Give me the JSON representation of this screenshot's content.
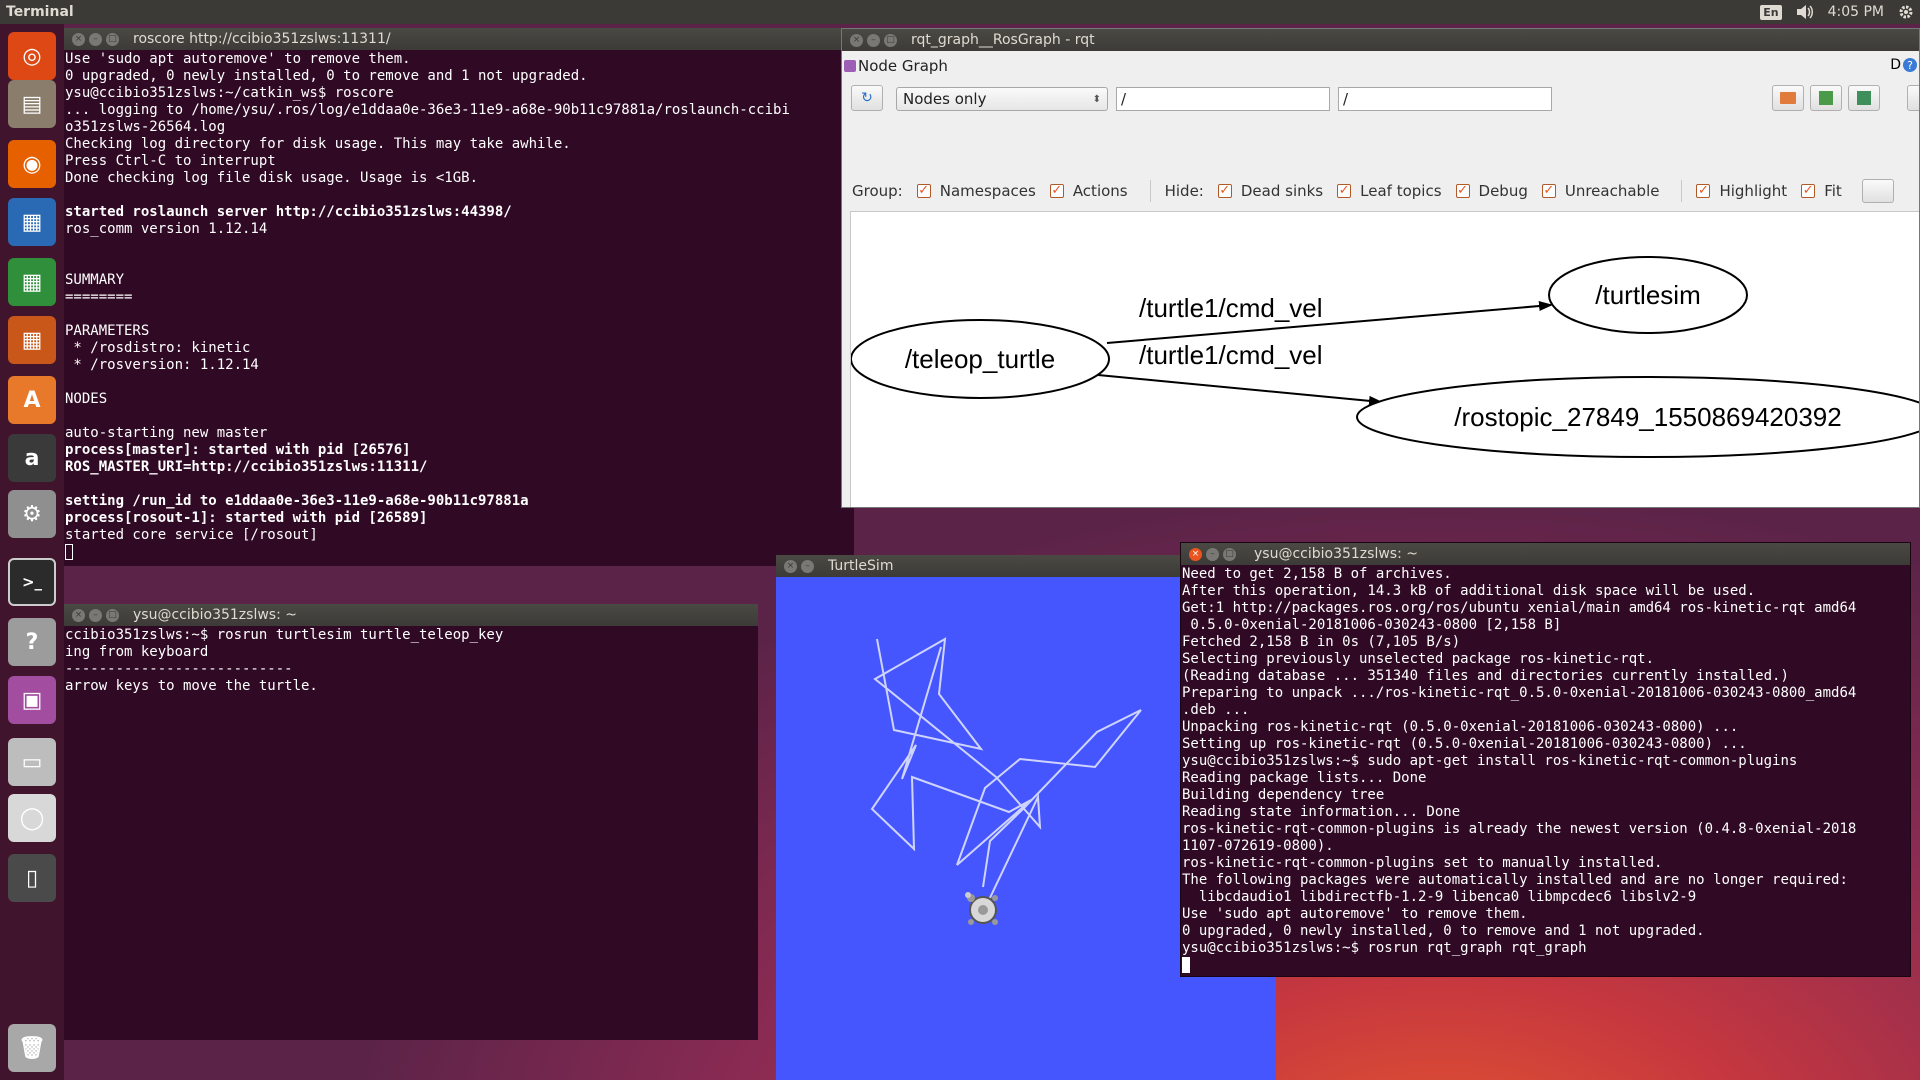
{
  "topbar": {
    "app_title": "Terminal",
    "keyboard": "En",
    "time": "4:05 PM"
  },
  "launcher": {
    "items": [
      {
        "name": "ubuntu-dash-icon",
        "color": "#dd4814",
        "glyph": "◎"
      },
      {
        "name": "files-icon",
        "color": "#8a7d6b",
        "glyph": "▤"
      },
      {
        "name": "firefox-icon",
        "color": "#e66000",
        "glyph": "◉"
      },
      {
        "name": "writer-icon",
        "color": "#2a6ab4",
        "glyph": "▦"
      },
      {
        "name": "calc-icon",
        "color": "#2f8f3b",
        "glyph": "▦"
      },
      {
        "name": "impress-icon",
        "color": "#c9571a",
        "glyph": "▦"
      },
      {
        "name": "software-center-icon",
        "color": "#e8782a",
        "glyph": "A"
      },
      {
        "name": "amazon-icon",
        "color": "#3a3a3a",
        "glyph": "a"
      },
      {
        "name": "system-settings-icon",
        "color": "#8f8f8f",
        "glyph": "⚙"
      },
      {
        "name": "terminal-icon",
        "color": "#2b2b2b",
        "glyph": ">_"
      },
      {
        "name": "help-icon",
        "color": "#9c9c9c",
        "glyph": "?"
      },
      {
        "name": "workspaces-icon",
        "color": "#a24d9f",
        "glyph": "▣"
      },
      {
        "name": "drive-icon",
        "color": "#bdbdbd",
        "glyph": "▭"
      },
      {
        "name": "dvd-icon",
        "color": "#d8d8d8",
        "glyph": "◯"
      },
      {
        "name": "device-icon",
        "color": "#4a4a4a",
        "glyph": "▯"
      },
      {
        "name": "trash-icon",
        "color": "#a8a8a8",
        "glyph": "🗑"
      }
    ]
  },
  "roscore_window": {
    "title": "roscore http://ccibio351zslws:11311/",
    "lines": [
      {
        "t": "Use 'sudo apt autoremove' to remove them.",
        "b": false
      },
      {
        "t": "0 upgraded, 0 newly installed, 0 to remove and 1 not upgraded.",
        "b": false
      },
      {
        "t": "ysu@ccibio351zslws:~/catkin_ws$ roscore",
        "b": false
      },
      {
        "t": "... logging to /home/ysu/.ros/log/e1ddaa0e-36e3-11e9-a68e-90b11c97881a/roslaunch-ccibi",
        "b": false
      },
      {
        "t": "o351zslws-26564.log",
        "b": false
      },
      {
        "t": "Checking log directory for disk usage. This may take awhile.",
        "b": false
      },
      {
        "t": "Press Ctrl-C to interrupt",
        "b": false
      },
      {
        "t": "Done checking log file disk usage. Usage is <1GB.",
        "b": false
      },
      {
        "t": "",
        "b": false
      },
      {
        "t": "started roslaunch server http://ccibio351zslws:44398/",
        "b": true
      },
      {
        "t": "ros_comm version 1.12.14",
        "b": false
      },
      {
        "t": "",
        "b": false
      },
      {
        "t": "",
        "b": false
      },
      {
        "t": "SUMMARY",
        "b": false
      },
      {
        "t": "========",
        "b": false
      },
      {
        "t": "",
        "b": false
      },
      {
        "t": "PARAMETERS",
        "b": false
      },
      {
        "t": " * /rosdistro: kinetic",
        "b": false
      },
      {
        "t": " * /rosversion: 1.12.14",
        "b": false
      },
      {
        "t": "",
        "b": false
      },
      {
        "t": "NODES",
        "b": false
      },
      {
        "t": "",
        "b": false
      },
      {
        "t": "auto-starting new master",
        "b": false
      },
      {
        "t": "process[master]: started with pid [26576]",
        "b": true
      },
      {
        "t": "ROS_MASTER_URI=http://ccibio351zslws:11311/",
        "b": true
      },
      {
        "t": "",
        "b": false
      },
      {
        "t": "setting /run_id to e1ddaa0e-36e3-11e9-a68e-90b11c97881a",
        "b": true
      },
      {
        "t": "process[rosout-1]: started with pid [26589]",
        "b": true
      },
      {
        "t": "started core service [/rosout]",
        "b": false
      }
    ]
  },
  "teleop_window": {
    "title": "ysu@ccibio351zslws: ~",
    "lines": [
      "ccibio351zslws:~$ rosrun turtlesim turtle_teleop_key",
      "ing from keyboard",
      "---------------------------",
      "arrow keys to move the turtle."
    ]
  },
  "rqt_window": {
    "title": "rqt_graph__RosGraph - rqt",
    "plugin_title": "Node Graph",
    "plugin_tools": "D",
    "view_mode": "Nodes only",
    "filter1": "/",
    "filter2": "/",
    "group_label": "Group:",
    "hide_label": "Hide:",
    "options": {
      "namespaces": "Namespaces",
      "actions": "Actions",
      "dead_sinks": "Dead sinks",
      "leaf_topics": "Leaf topics",
      "debug": "Debug",
      "unreachable": "Unreachable",
      "highlight": "Highlight",
      "fit": "Fit"
    },
    "graph": {
      "node_teleop": "/teleop_turtle",
      "node_turtlesim": "/turtlesim",
      "node_rostopic": "/rostopic_27849_1550869420392",
      "edge1": "/turtle1/cmd_vel",
      "edge2": "/turtle1/cmd_vel"
    }
  },
  "turtlesim_window": {
    "title": "TurtleSim",
    "background": "#4556ff"
  },
  "apt_window": {
    "title": "ysu@ccibio351zslws: ~",
    "lines": [
      "Need to get 2,158 B of archives.",
      "After this operation, 14.3 kB of additional disk space will be used.",
      "Get:1 http://packages.ros.org/ros/ubuntu xenial/main amd64 ros-kinetic-rqt amd64",
      " 0.5.0-0xenial-20181006-030243-0800 [2,158 B]",
      "Fetched 2,158 B in 0s (7,105 B/s)",
      "Selecting previously unselected package ros-kinetic-rqt.",
      "(Reading database ... 351340 files and directories currently installed.)",
      "Preparing to unpack .../ros-kinetic-rqt_0.5.0-0xenial-20181006-030243-0800_amd64",
      ".deb ...",
      "Unpacking ros-kinetic-rqt (0.5.0-0xenial-20181006-030243-0800) ...",
      "Setting up ros-kinetic-rqt (0.5.0-0xenial-20181006-030243-0800) ...",
      "ysu@ccibio351zslws:~$ sudo apt-get install ros-kinetic-rqt-common-plugins",
      "Reading package lists... Done",
      "Building dependency tree",
      "Reading state information... Done",
      "ros-kinetic-rqt-common-plugins is already the newest version (0.4.8-0xenial-2018",
      "1107-072619-0800).",
      "ros-kinetic-rqt-common-plugins set to manually installed.",
      "The following packages were automatically installed and are no longer required:",
      "  libcdaudio1 libdirectfb-1.2-9 libenca0 libmpcdec6 libslv2-9",
      "Use 'sudo apt autoremove' to remove them.",
      "0 upgraded, 0 newly installed, 0 to remove and 1 not upgraded.",
      "ysu@ccibio351zslws:~$ rosrun rqt_graph rqt_graph"
    ]
  }
}
